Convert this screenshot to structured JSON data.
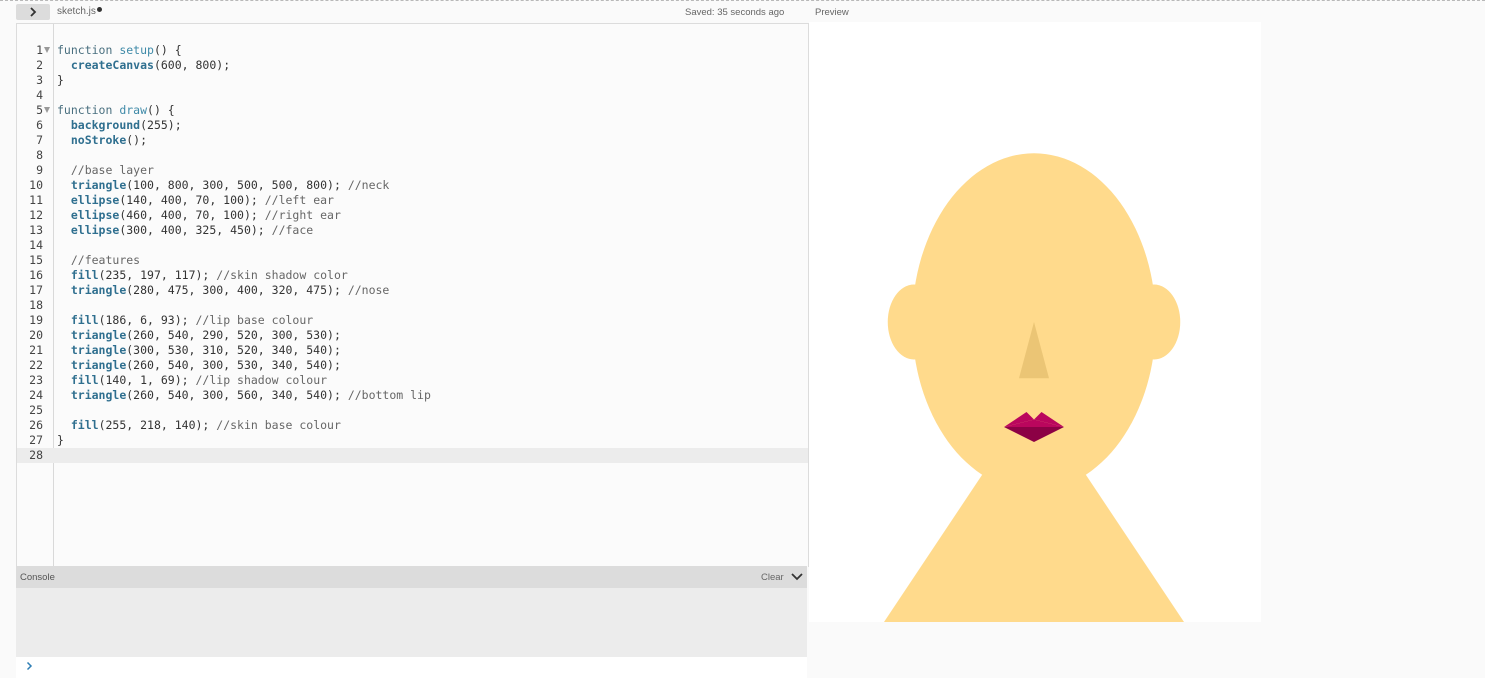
{
  "toolbar": {
    "filename": "sketch.js",
    "save_status": "Saved: 35 seconds ago"
  },
  "preview": {
    "label": "Preview"
  },
  "editor": {
    "lines": [
      "function setup() {",
      "  createCanvas(600, 800);",
      "}",
      "",
      "function draw() {",
      "  background(255);",
      "  noStroke();",
      "",
      "  //base layer",
      "  triangle(100, 800, 300, 500, 500, 800); //neck",
      "  ellipse(140, 400, 70, 100); //left ear",
      "  ellipse(460, 400, 70, 100); //right ear",
      "  ellipse(300, 400, 325, 450); //face",
      "",
      "  //features",
      "  fill(235, 197, 117); //skin shadow color",
      "  triangle(280, 475, 300, 400, 320, 475); //nose",
      "",
      "  fill(186, 6, 93); //lip base colour",
      "  triangle(260, 540, 290, 520, 300, 530);",
      "  triangle(300, 530, 310, 520, 340, 540);",
      "  triangle(260, 540, 300, 530, 340, 540);",
      "  fill(140, 1, 69); //lip shadow colour",
      "  triangle(260, 540, 300, 560, 340, 540); //bottom lip",
      "",
      "  fill(255, 218, 140); //skin base colour",
      "}",
      ""
    ],
    "fold_lines": [
      1,
      5
    ],
    "active_line": 28
  },
  "console": {
    "title": "Console",
    "clear_label": "Clear"
  },
  "colors": {
    "skin_base": "#ffda8c",
    "skin_shadow": "#ebc575",
    "lip_base": "#ba065d",
    "lip_shadow": "#8c0145",
    "accent": "#2f6f8f"
  },
  "icons": {
    "sidebar_toggle": "chevron-right-icon",
    "console_collapse": "chevron-down-icon",
    "console_prompt": "chevron-right-icon"
  }
}
